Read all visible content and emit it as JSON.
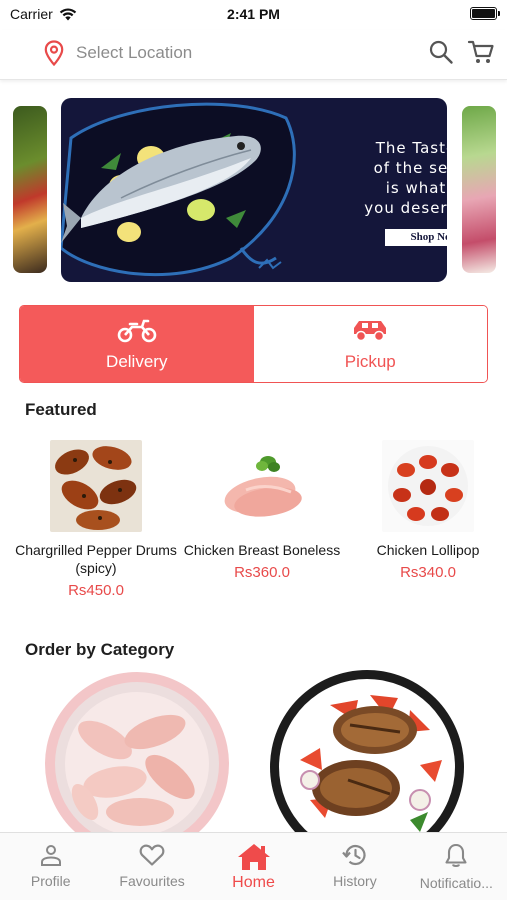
{
  "status_bar": {
    "carrier": "Carrier",
    "time": "2:41 PM"
  },
  "header": {
    "location_placeholder": "Select Location",
    "icons": [
      "location-pin-icon",
      "search-icon",
      "cart-icon"
    ]
  },
  "banner": {
    "tagline_lines": [
      "The Taste",
      "of the sea",
      "is what",
      "you deserve"
    ],
    "cta_label": "Shop Now"
  },
  "order_mode": {
    "options": [
      {
        "label": "Delivery",
        "icon": "motorbike-icon",
        "selected": true
      },
      {
        "label": "Pickup",
        "icon": "car-icon",
        "selected": false
      }
    ]
  },
  "featured": {
    "title": "Featured",
    "items": [
      {
        "name": "Chargrilled Pepper Drums (spicy)",
        "price": "Rs450.0"
      },
      {
        "name": "Chicken Breast Boneless",
        "price": "Rs360.0"
      },
      {
        "name": "Chicken Lollipop",
        "price": "Rs340.0"
      }
    ]
  },
  "categories": {
    "title": "Order by Category"
  },
  "tabbar": {
    "tabs": [
      {
        "label": "Profile",
        "icon": "person-icon"
      },
      {
        "label": "Favourites",
        "icon": "heart-icon"
      },
      {
        "label": "Home",
        "icon": "home-icon",
        "active": true
      },
      {
        "label": "History",
        "icon": "history-icon"
      },
      {
        "label": "Notificatio...",
        "icon": "bell-icon"
      }
    ]
  },
  "colors": {
    "accent": "#f45a5a",
    "price": "#e84a4a",
    "banner_bg": "#14163a"
  }
}
